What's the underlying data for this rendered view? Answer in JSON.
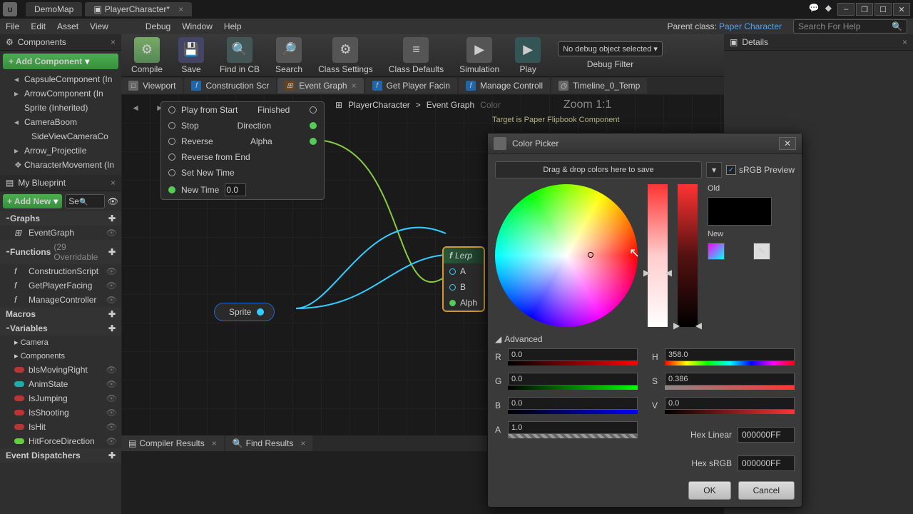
{
  "title": {
    "doc1": "DemoMap",
    "doc2": "PlayerCharacter*"
  },
  "winbtns": {
    "min": "–",
    "restore": "❐",
    "max": "☐",
    "close": "✕"
  },
  "menubar": {
    "file": "File",
    "edit": "Edit",
    "asset": "Asset",
    "view": "View",
    "debug": "Debug",
    "window": "Window",
    "help": "Help",
    "parent_label": "Parent class:",
    "parent_value": "Paper Character",
    "search_ph": "Search For Help"
  },
  "components": {
    "header": "Components",
    "add": "+ Add Component",
    "items": [
      {
        "exp": "◂",
        "label": "CapsuleComponent (In"
      },
      {
        "exp": "▸",
        "label": "ArrowComponent (In"
      },
      {
        "exp": "",
        "label": "Sprite (Inherited)"
      },
      {
        "exp": "◂",
        "label": "CameraBoom"
      },
      {
        "exp": "",
        "label": "SideViewCameraCo",
        "l2": true
      },
      {
        "exp": "▸",
        "label": "Arrow_Projectile"
      },
      {
        "exp": "❖",
        "label": "CharacterMovement (In"
      }
    ]
  },
  "myblueprint": {
    "header": "My Blueprint",
    "addnew": "+ Add New",
    "search_ph": "Se",
    "sections": {
      "graphs": {
        "title": "⁃Graphs",
        "items": [
          {
            "ico": "⊞",
            "label": "EventGraph"
          }
        ]
      },
      "functions": {
        "title": "⁃Functions",
        "hint": "(29 Overridable",
        "items": [
          {
            "ico": "f",
            "label": "ConstructionScript"
          },
          {
            "ico": "f",
            "label": "GetPlayerFacing"
          },
          {
            "ico": "f",
            "label": "ManageController"
          }
        ]
      },
      "macros": {
        "title": "Macros"
      },
      "variables": {
        "title": "⁃Variables",
        "groups": [
          {
            "label": "▸ Camera"
          },
          {
            "label": "▸ Components"
          }
        ],
        "items": [
          {
            "col": "#b33",
            "label": "bIsMovingRight"
          },
          {
            "col": "#2aa",
            "label": "AnimState"
          },
          {
            "col": "#b33",
            "label": "IsJumping"
          },
          {
            "col": "#b33",
            "label": "IsShooting"
          },
          {
            "col": "#b33",
            "label": "IsHit"
          },
          {
            "col": "#6c4",
            "label": "HitForceDirection"
          }
        ]
      },
      "dispatchers": {
        "title": "Event Dispatchers"
      }
    }
  },
  "toolbar": {
    "items": [
      {
        "label": "Compile",
        "ico": "⚙"
      },
      {
        "label": "Save",
        "ico": "💾"
      },
      {
        "label": "Find in CB",
        "ico": "🔍"
      },
      {
        "label": "Search",
        "ico": "🔎"
      },
      {
        "label": "Class Settings",
        "ico": "⚙"
      },
      {
        "label": "Class Defaults",
        "ico": "≡"
      },
      {
        "label": "Simulation",
        "ico": "▶"
      },
      {
        "label": "Play",
        "ico": "▶"
      }
    ],
    "debug_sel": "No debug object selected ▾",
    "debug_label": "Debug Filter"
  },
  "graphtabs": [
    {
      "ico": "□",
      "label": "Viewport"
    },
    {
      "icoCls": "f",
      "ico": "f",
      "label": "Construction Scr"
    },
    {
      "icoCls": "s",
      "ico": "⊞",
      "label": "Event Graph",
      "active": true,
      "closable": true
    },
    {
      "icoCls": "f",
      "ico": "f",
      "label": "Get Player Facin"
    },
    {
      "icoCls": "f",
      "ico": "f",
      "label": "Manage Controll"
    },
    {
      "ico": "◷",
      "label": "Timeline_0_Temp"
    }
  ],
  "breadcrumb": {
    "root": "PlayerCharacter",
    "sep": ">",
    "leaf": "Event Graph",
    "zoom": "Zoom 1:1",
    "hint": "Color",
    "sub": "Target is Paper Flipbook Component"
  },
  "timeline": {
    "rows": [
      {
        "pin": "▷",
        "label": "Play from Start",
        "out": "Finished",
        "outpin": "▷"
      },
      {
        "pin": "▷",
        "label": "Stop",
        "out": "Direction",
        "outpinCls": "green"
      },
      {
        "pin": "▷",
        "label": "Reverse",
        "out": "Alpha",
        "outpinCls": "green filled"
      },
      {
        "pin": "▷",
        "label": "Reverse from End"
      },
      {
        "pin": "▷",
        "label": "Set New Time"
      },
      {
        "pin": "○",
        "pinCls": "green",
        "label": "New Time",
        "value": "0.0"
      }
    ]
  },
  "sprite": {
    "label": "Sprite"
  },
  "lerp": {
    "title": "Lerp",
    "rows": [
      {
        "pin": "blue",
        "label": "A"
      },
      {
        "pin": "blue",
        "label": "B"
      },
      {
        "pin": "green",
        "label": "Alph"
      }
    ]
  },
  "bottom": {
    "compiler": "Compiler Results",
    "find": "Find Results"
  },
  "details": {
    "header": "Details"
  },
  "colorpicker": {
    "title": "Color Picker",
    "drop": "Drag & drop colors here to save",
    "srgb": "sRGB Preview",
    "old": "Old",
    "new": "New",
    "adv": "Advanced",
    "r": {
      "lbl": "R",
      "val": "0.0"
    },
    "g": {
      "lbl": "G",
      "val": "0.0"
    },
    "b": {
      "lbl": "B",
      "val": "0.0"
    },
    "a": {
      "lbl": "A",
      "val": "1.0"
    },
    "h": {
      "lbl": "H",
      "val": "358.0"
    },
    "s": {
      "lbl": "S",
      "val": "0.386"
    },
    "v": {
      "lbl": "V",
      "val": "0.0"
    },
    "hexlin": {
      "lbl": "Hex Linear",
      "val": "000000FF"
    },
    "hexsrgb": {
      "lbl": "Hex sRGB",
      "val": "000000FF"
    },
    "ok": "OK",
    "cancel": "Cancel"
  }
}
